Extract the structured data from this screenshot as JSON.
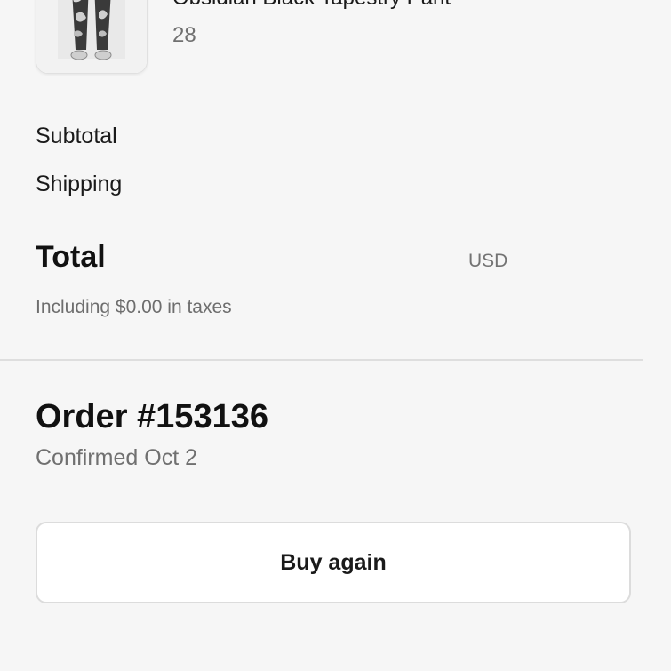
{
  "product": {
    "name": "Obsidian Black Tapestry Pant",
    "quantity": "28"
  },
  "summary": {
    "subtotal_label": "Subtotal",
    "shipping_label": "Shipping",
    "total_label": "Total",
    "currency": "USD",
    "taxes_note": "Including $0.00 in taxes"
  },
  "order": {
    "title": "Order #153136",
    "status": "Confirmed Oct 2"
  },
  "actions": {
    "buy_again_label": "Buy again"
  }
}
